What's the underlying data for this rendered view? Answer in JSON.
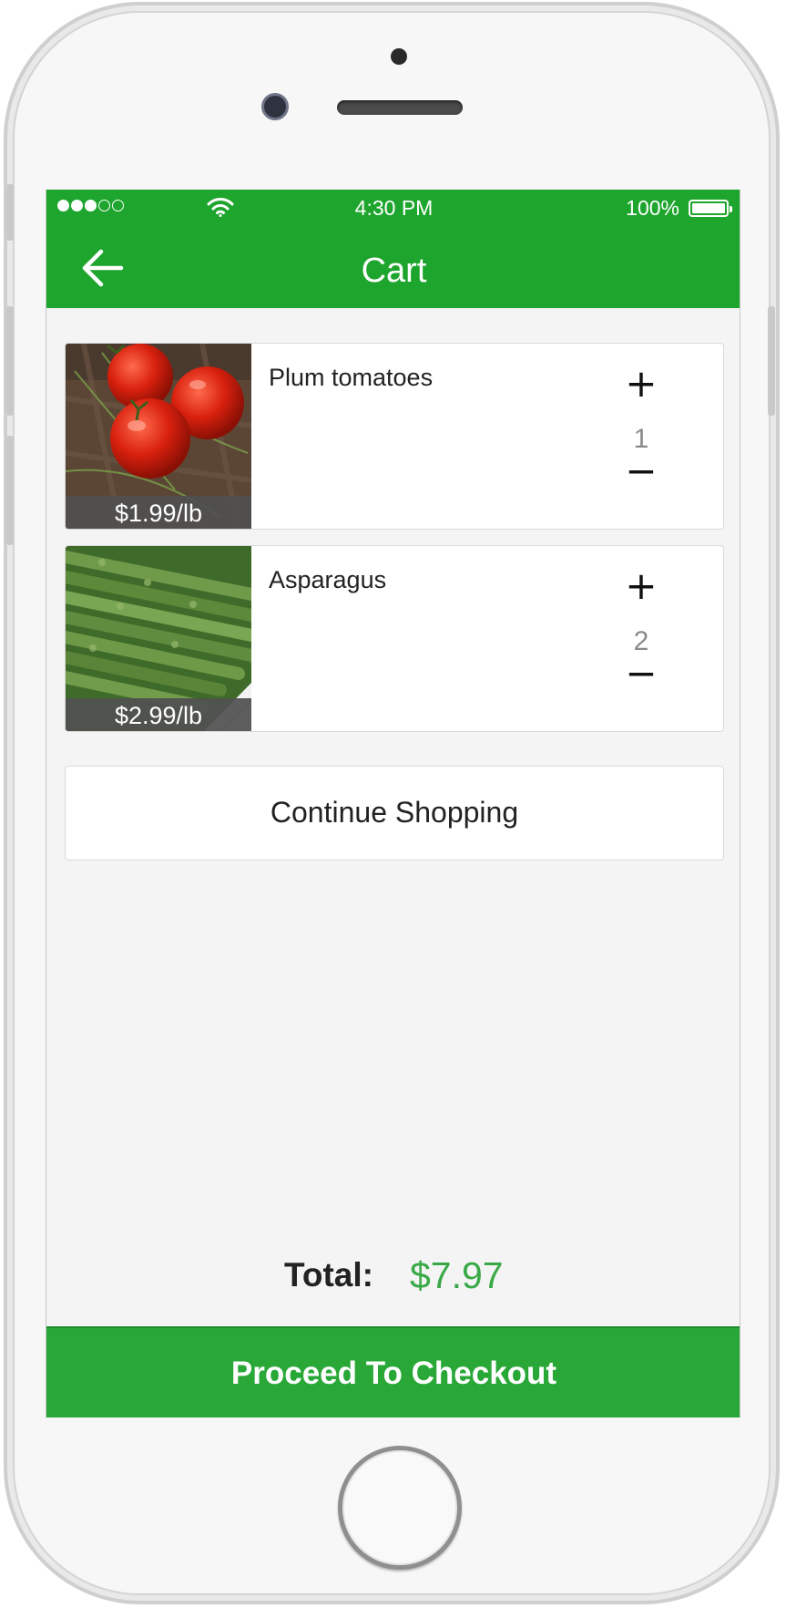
{
  "status_bar": {
    "time": "4:30 PM",
    "battery": "100%"
  },
  "header": {
    "title": "Cart",
    "back_icon": "arrow-left-icon",
    "color": "#1ea52d"
  },
  "cart": {
    "items": [
      {
        "name": "Plum tomatoes",
        "price": "$1.99/lb",
        "quantity": "1",
        "plus": "+",
        "minus": "−",
        "image": "tomatoes-photo"
      },
      {
        "name": "Asparagus",
        "price": "$2.99/lb",
        "quantity": "2",
        "plus": "+",
        "minus": "−",
        "image": "asparagus-photo"
      }
    ],
    "continue_label": "Continue Shopping"
  },
  "summary": {
    "total_label": "Total:",
    "total_value": "$7.97",
    "total_color": "#39a947"
  },
  "checkout": {
    "label": "Proceed To Checkout",
    "color": "#29a838"
  }
}
